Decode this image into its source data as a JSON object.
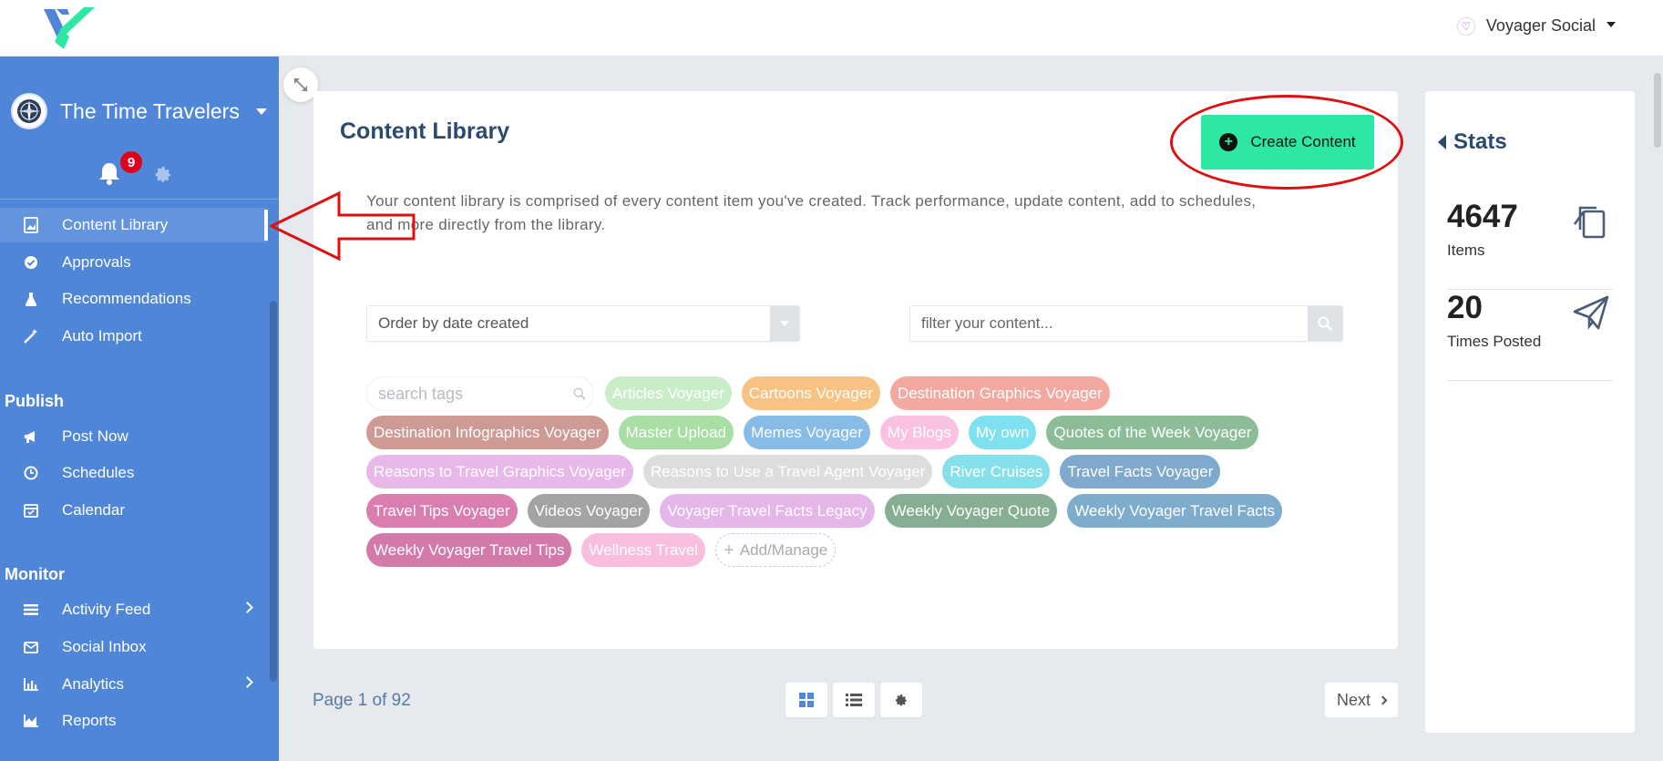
{
  "header": {
    "account_name": "Voyager Social"
  },
  "sidebar": {
    "team_name": "The Time Travelers",
    "notification_count": "9",
    "items_top": [
      {
        "label": "Content Library",
        "icon": "image-file-icon",
        "active": true
      },
      {
        "label": "Approvals",
        "icon": "check-circle-icon"
      },
      {
        "label": "Recommendations",
        "icon": "flask-icon"
      },
      {
        "label": "Auto Import",
        "icon": "magic-wand-icon"
      }
    ],
    "publish_title": "Publish",
    "publish_items": [
      {
        "label": "Post Now",
        "icon": "megaphone-icon"
      },
      {
        "label": "Schedules",
        "icon": "clock-icon"
      },
      {
        "label": "Calendar",
        "icon": "calendar-check-icon"
      }
    ],
    "monitor_title": "Monitor",
    "monitor_items": [
      {
        "label": "Activity Feed",
        "icon": "list-icon",
        "has_submenu": true
      },
      {
        "label": "Social Inbox",
        "icon": "envelope-icon"
      },
      {
        "label": "Analytics",
        "icon": "bar-chart-icon",
        "has_submenu": true
      },
      {
        "label": "Reports",
        "icon": "area-chart-icon"
      }
    ]
  },
  "main": {
    "title": "Content Library",
    "create_button": "Create Content",
    "description": "Your content library is comprised of every content item you've created. Track performance, update content, add to schedules, and more directly from the library.",
    "order_select": {
      "value": "Order by date created"
    },
    "filter": {
      "placeholder": "filter your content..."
    },
    "tag_search": {
      "placeholder": "search tags"
    },
    "tag_rows": [
      [
        {
          "label": "Articles Voyager",
          "color": "#c9ecc9"
        },
        {
          "label": "Cartoons Voyager",
          "color": "#f8c283"
        },
        {
          "label": "Destination Graphics Voyager",
          "color": "#f3a9a0"
        }
      ],
      [
        {
          "label": "Destination Infographics Voyager",
          "color": "#cd9a94"
        },
        {
          "label": "Master Upload",
          "color": "#a9dea5"
        },
        {
          "label": "Memes Voyager",
          "color": "#86bce6"
        },
        {
          "label": "My Blogs",
          "color": "#f9c2e2"
        },
        {
          "label": "My own",
          "color": "#7fe1ef"
        },
        {
          "label": "Quotes of the Week Voyager",
          "color": "#8dbd98"
        }
      ],
      [
        {
          "label": "Reasons to Travel Graphics Voyager",
          "color": "#e7b8e8"
        },
        {
          "label": "Reasons to Use a Travel Agent Voyager",
          "color": "#dddddd"
        },
        {
          "label": "River Cruises",
          "color": "#86e0ec"
        },
        {
          "label": "Travel Facts Voyager",
          "color": "#7fa9cd"
        }
      ],
      [
        {
          "label": "Travel Tips Voyager",
          "color": "#d97eaf"
        },
        {
          "label": "Videos Voyager",
          "color": "#a3a3a3"
        },
        {
          "label": "Voyager Travel Facts Legacy",
          "color": "#e5b6ea"
        },
        {
          "label": "Weekly Voyager Quote",
          "color": "#85ae92"
        },
        {
          "label": "Weekly Voyager Travel Facts",
          "color": "#7eaccd"
        }
      ],
      [
        {
          "label": "Weekly Voyager Travel Tips",
          "color": "#d47aab"
        },
        {
          "label": "Wellness Travel",
          "color": "#f9bde0"
        }
      ]
    ],
    "add_manage_label": "Add/Manage",
    "pager_text": "Page 1 of 92",
    "next_label": "Next"
  },
  "stats": {
    "title": "Stats",
    "items": [
      {
        "value": "4647",
        "label": "Items",
        "icon": "copy-icon"
      },
      {
        "value": "20",
        "label": "Times Posted",
        "icon": "paper-plane-icon"
      }
    ]
  },
  "colors": {
    "sidebar": "#4f86d8",
    "accent": "#2de8a3",
    "title": "#2c4a6e",
    "annotation": "#e01010"
  }
}
